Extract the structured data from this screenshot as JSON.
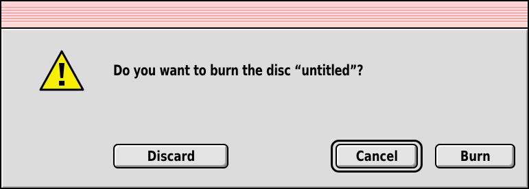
{
  "dialog": {
    "icon": "warning-icon",
    "message": "Do you want to burn the disc “untitled”?",
    "buttons": {
      "discard_label": "Discard",
      "cancel_label": "Cancel",
      "burn_label": "Burn"
    },
    "default_button": "Cancel"
  },
  "colors": {
    "title_bar_stripe": "#f7a8a8",
    "title_bar_light": "#fde4e4",
    "dialog_background": "#dcdcdc",
    "icon_yellow": "#f8f000"
  }
}
